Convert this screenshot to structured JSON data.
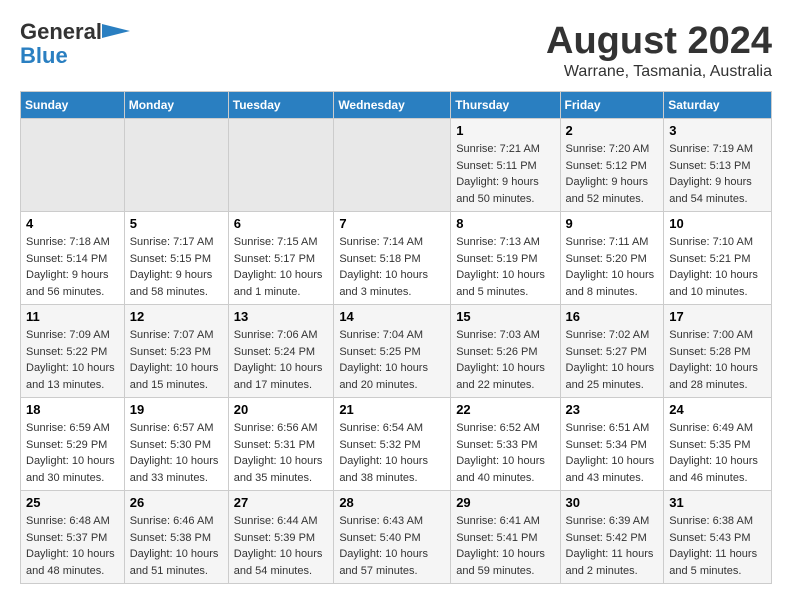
{
  "header": {
    "logo_line1": "General",
    "logo_line2": "Blue",
    "main_title": "August 2024",
    "subtitle": "Warrane, Tasmania, Australia"
  },
  "days_of_week": [
    "Sunday",
    "Monday",
    "Tuesday",
    "Wednesday",
    "Thursday",
    "Friday",
    "Saturday"
  ],
  "weeks": [
    [
      {
        "day": "",
        "info": ""
      },
      {
        "day": "",
        "info": ""
      },
      {
        "day": "",
        "info": ""
      },
      {
        "day": "",
        "info": ""
      },
      {
        "day": "1",
        "info": "Sunrise: 7:21 AM\nSunset: 5:11 PM\nDaylight: 9 hours and 50 minutes."
      },
      {
        "day": "2",
        "info": "Sunrise: 7:20 AM\nSunset: 5:12 PM\nDaylight: 9 hours and 52 minutes."
      },
      {
        "day": "3",
        "info": "Sunrise: 7:19 AM\nSunset: 5:13 PM\nDaylight: 9 hours and 54 minutes."
      }
    ],
    [
      {
        "day": "4",
        "info": "Sunrise: 7:18 AM\nSunset: 5:14 PM\nDaylight: 9 hours and 56 minutes."
      },
      {
        "day": "5",
        "info": "Sunrise: 7:17 AM\nSunset: 5:15 PM\nDaylight: 9 hours and 58 minutes."
      },
      {
        "day": "6",
        "info": "Sunrise: 7:15 AM\nSunset: 5:17 PM\nDaylight: 10 hours and 1 minute."
      },
      {
        "day": "7",
        "info": "Sunrise: 7:14 AM\nSunset: 5:18 PM\nDaylight: 10 hours and 3 minutes."
      },
      {
        "day": "8",
        "info": "Sunrise: 7:13 AM\nSunset: 5:19 PM\nDaylight: 10 hours and 5 minutes."
      },
      {
        "day": "9",
        "info": "Sunrise: 7:11 AM\nSunset: 5:20 PM\nDaylight: 10 hours and 8 minutes."
      },
      {
        "day": "10",
        "info": "Sunrise: 7:10 AM\nSunset: 5:21 PM\nDaylight: 10 hours and 10 minutes."
      }
    ],
    [
      {
        "day": "11",
        "info": "Sunrise: 7:09 AM\nSunset: 5:22 PM\nDaylight: 10 hours and 13 minutes."
      },
      {
        "day": "12",
        "info": "Sunrise: 7:07 AM\nSunset: 5:23 PM\nDaylight: 10 hours and 15 minutes."
      },
      {
        "day": "13",
        "info": "Sunrise: 7:06 AM\nSunset: 5:24 PM\nDaylight: 10 hours and 17 minutes."
      },
      {
        "day": "14",
        "info": "Sunrise: 7:04 AM\nSunset: 5:25 PM\nDaylight: 10 hours and 20 minutes."
      },
      {
        "day": "15",
        "info": "Sunrise: 7:03 AM\nSunset: 5:26 PM\nDaylight: 10 hours and 22 minutes."
      },
      {
        "day": "16",
        "info": "Sunrise: 7:02 AM\nSunset: 5:27 PM\nDaylight: 10 hours and 25 minutes."
      },
      {
        "day": "17",
        "info": "Sunrise: 7:00 AM\nSunset: 5:28 PM\nDaylight: 10 hours and 28 minutes."
      }
    ],
    [
      {
        "day": "18",
        "info": "Sunrise: 6:59 AM\nSunset: 5:29 PM\nDaylight: 10 hours and 30 minutes."
      },
      {
        "day": "19",
        "info": "Sunrise: 6:57 AM\nSunset: 5:30 PM\nDaylight: 10 hours and 33 minutes."
      },
      {
        "day": "20",
        "info": "Sunrise: 6:56 AM\nSunset: 5:31 PM\nDaylight: 10 hours and 35 minutes."
      },
      {
        "day": "21",
        "info": "Sunrise: 6:54 AM\nSunset: 5:32 PM\nDaylight: 10 hours and 38 minutes."
      },
      {
        "day": "22",
        "info": "Sunrise: 6:52 AM\nSunset: 5:33 PM\nDaylight: 10 hours and 40 minutes."
      },
      {
        "day": "23",
        "info": "Sunrise: 6:51 AM\nSunset: 5:34 PM\nDaylight: 10 hours and 43 minutes."
      },
      {
        "day": "24",
        "info": "Sunrise: 6:49 AM\nSunset: 5:35 PM\nDaylight: 10 hours and 46 minutes."
      }
    ],
    [
      {
        "day": "25",
        "info": "Sunrise: 6:48 AM\nSunset: 5:37 PM\nDaylight: 10 hours and 48 minutes."
      },
      {
        "day": "26",
        "info": "Sunrise: 6:46 AM\nSunset: 5:38 PM\nDaylight: 10 hours and 51 minutes."
      },
      {
        "day": "27",
        "info": "Sunrise: 6:44 AM\nSunset: 5:39 PM\nDaylight: 10 hours and 54 minutes."
      },
      {
        "day": "28",
        "info": "Sunrise: 6:43 AM\nSunset: 5:40 PM\nDaylight: 10 hours and 57 minutes."
      },
      {
        "day": "29",
        "info": "Sunrise: 6:41 AM\nSunset: 5:41 PM\nDaylight: 10 hours and 59 minutes."
      },
      {
        "day": "30",
        "info": "Sunrise: 6:39 AM\nSunset: 5:42 PM\nDaylight: 11 hours and 2 minutes."
      },
      {
        "day": "31",
        "info": "Sunrise: 6:38 AM\nSunset: 5:43 PM\nDaylight: 11 hours and 5 minutes."
      }
    ]
  ]
}
